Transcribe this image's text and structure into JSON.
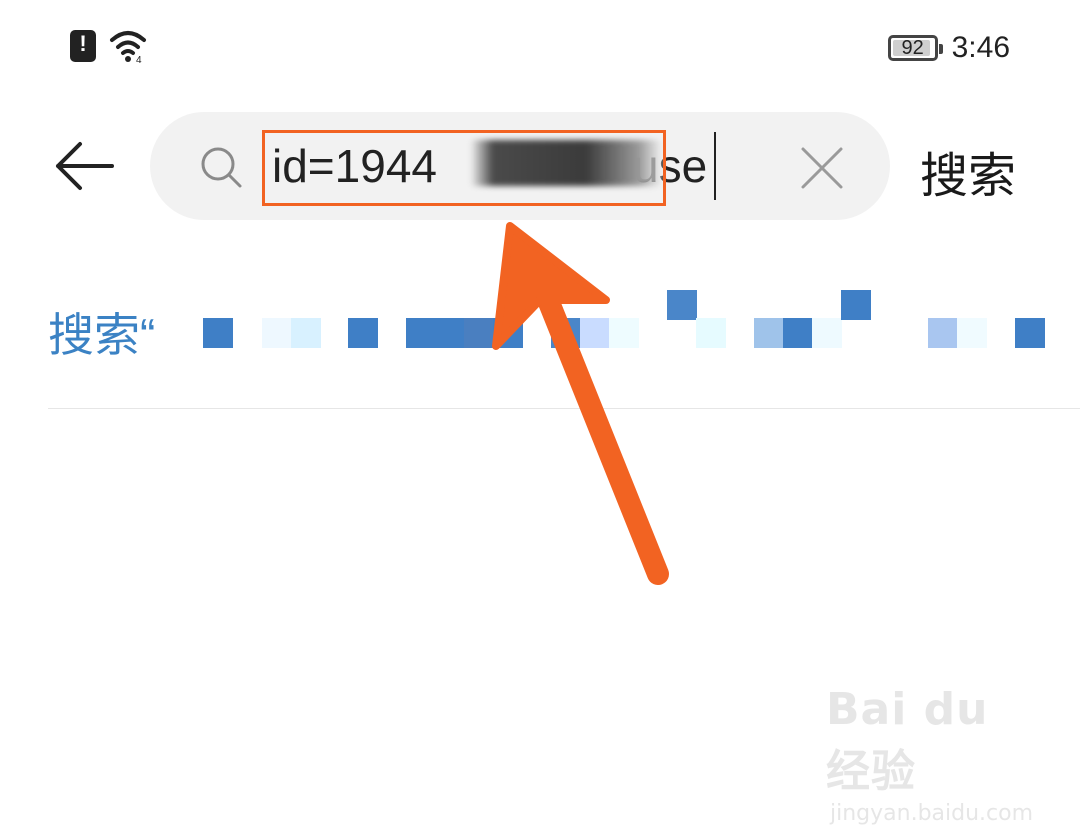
{
  "status_bar": {
    "battery_level": "92",
    "battery_fraction": 0.92,
    "time": "3:46",
    "icons": [
      "alert-icon",
      "wifi-icon",
      "battery-icon"
    ]
  },
  "search": {
    "back_icon": "arrow-left-icon",
    "search_icon": "search-icon",
    "query_visible_prefix": "id=1944",
    "query_visible_suffix": "use",
    "clear_icon": "close-icon",
    "action_label": "搜索"
  },
  "suggestion": {
    "label": "搜索“"
  },
  "annotation": {
    "color": "#f26322",
    "type": "arrow-and-box"
  },
  "watermark": {
    "logo_text": "Bai du 经验",
    "url": "jingyan.baidu.com"
  },
  "colors": {
    "accent_blue": "#3b82c4",
    "search_box_bg": "#f2f2f2",
    "annotation_orange": "#f26322"
  }
}
